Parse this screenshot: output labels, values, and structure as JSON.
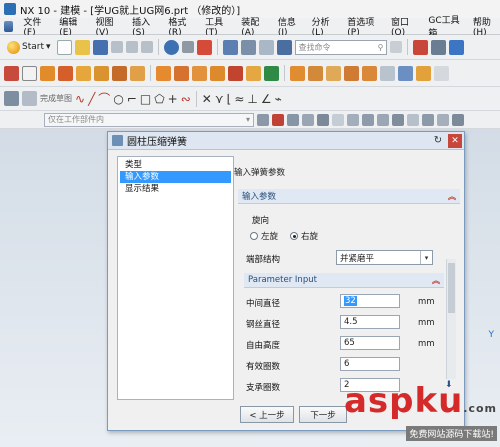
{
  "window": {
    "title": "NX 10 - 建模 - [学UG就上UG网6.prt （修改的）]"
  },
  "menubar": {
    "items": [
      "文件(F)",
      "编辑(E)",
      "视图(V)",
      "插入(S)",
      "格式(R)",
      "工具(T)",
      "装配(A)",
      "信息(I)",
      "分析(L)",
      "首选项(P)",
      "窗口(O)",
      "GC工具箱",
      "帮助(H)"
    ]
  },
  "toolbar1": {
    "start_label": "Start",
    "search_placeholder": "查找命令"
  },
  "toolbar3": {
    "sketch_label": "完成草图"
  },
  "toolbar4": {
    "filter_label": "仅在工作部件内"
  },
  "dialog": {
    "title": "圆柱压缩弹簧",
    "nav_items": [
      "类型",
      "输入参数",
      "显示结果"
    ],
    "page_title": "输入弹簧参数",
    "group_input": "输入参数",
    "rotation_label": "旋向",
    "left_hand": "左旋",
    "right_hand": "右旋",
    "end_structure_label": "端部结构",
    "end_structure_value": "并紧磨平",
    "group_param": "Parameter Input",
    "params": [
      {
        "label": "中间直径",
        "value": "32",
        "unit": "mm"
      },
      {
        "label": "钢丝直径",
        "value": "4.5",
        "unit": "mm"
      },
      {
        "label": "自由高度",
        "value": "65",
        "unit": "mm"
      },
      {
        "label": "有效圈数",
        "value": "6"
      },
      {
        "label": "支承圈数",
        "value": "2"
      }
    ],
    "back_button": "< 上一步",
    "next_button": "下一步"
  },
  "workspace": {
    "axis_label": "Y"
  },
  "watermark": {
    "main": "aspku",
    "domain": ".com",
    "sub": "免费网站源码下载站!"
  },
  "colors": {
    "accent": "#3399ff",
    "close": "#c8473b",
    "watermark": "#d42a2a"
  }
}
